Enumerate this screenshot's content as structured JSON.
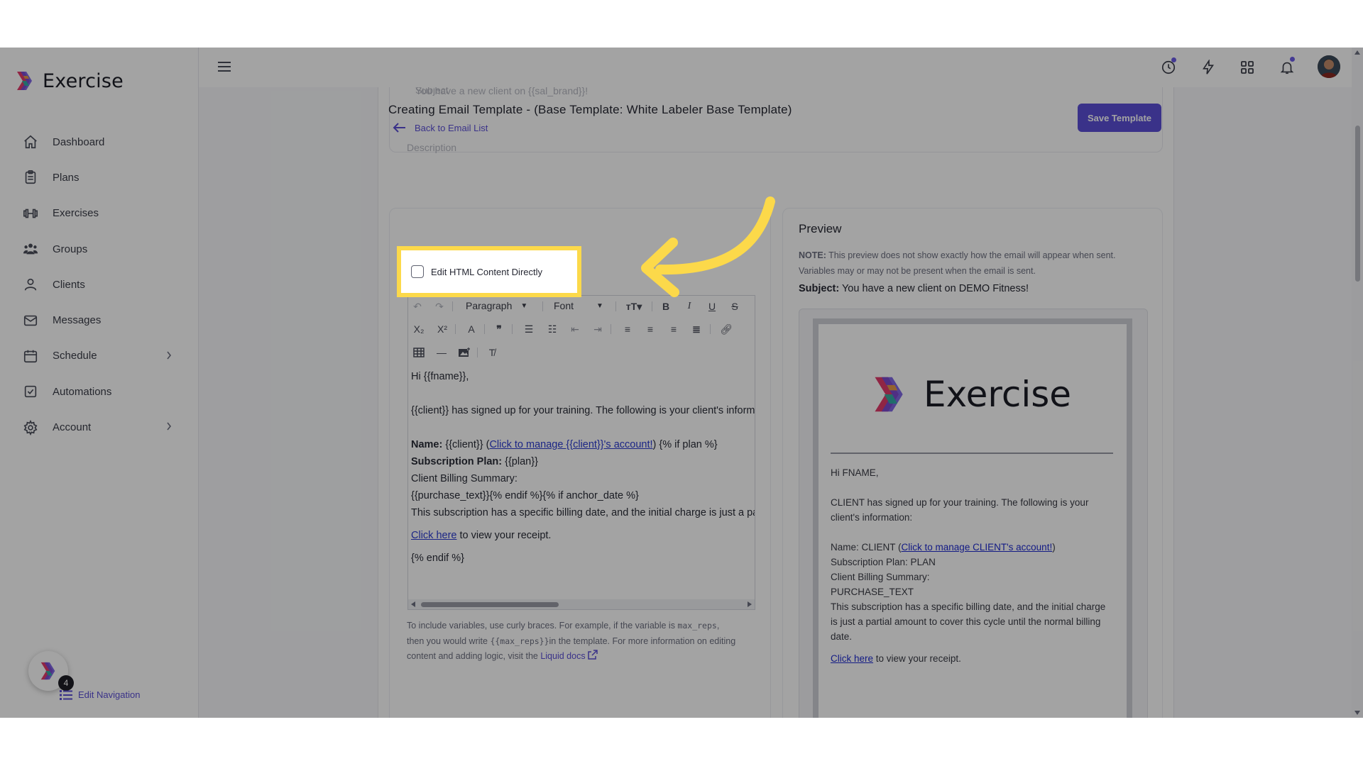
{
  "brand": {
    "name": "Exercise"
  },
  "sidebar": {
    "items": [
      {
        "label": "Dashboard",
        "icon": "home-icon"
      },
      {
        "label": "Plans",
        "icon": "clipboard-icon"
      },
      {
        "label": "Exercises",
        "icon": "dumbbell-icon"
      },
      {
        "label": "Groups",
        "icon": "users-icon"
      },
      {
        "label": "Clients",
        "icon": "user-icon"
      },
      {
        "label": "Messages",
        "icon": "mail-icon"
      },
      {
        "label": "Schedule",
        "icon": "calendar-icon",
        "has_submenu": true
      },
      {
        "label": "Automations",
        "icon": "checkbox-icon"
      },
      {
        "label": "Account",
        "icon": "gear-icon",
        "has_submenu": true
      }
    ],
    "help_badge_count": "4",
    "edit_navigation_label": "Edit Navigation"
  },
  "topbar": {
    "icons": [
      "history-icon",
      "lightning-icon",
      "apps-grid-icon",
      "bell-icon",
      "user-avatar"
    ]
  },
  "page": {
    "ghost_texts": [
      "Subject",
      "You have a new client on {{sal_brand}}!",
      "Description"
    ],
    "title": "Creating Email Template - (Base Template: White Labeler Base Template)",
    "back_label": "Back to Email List",
    "save_label": "Save Template"
  },
  "editor": {
    "html_toggle_label": "Edit HTML Content Directly",
    "html_toggle_checked": false,
    "paragraph_select": "Paragraph",
    "font_select": "Font",
    "content": {
      "greeting": "Hi {{fname}},",
      "intro": "{{client}} has signed up for your training. The following is your client's information:",
      "name_label": "Name:",
      "name_value": "{{client}} (",
      "name_link": "Click to manage {{client}}'s account!",
      "name_tail": ") {% if plan %}",
      "plan_label": "Subscription Plan:",
      "plan_value": "{{plan}}",
      "billing": "Client Billing Summary:",
      "purchase": "{{purchase_text}}{% endif %}{% if anchor_date %}",
      "anchor": "This subscription has a specific billing date, and the initial charge is just a partial amount to cover this cycle until the normal billing date.",
      "receipt_link": "Click here",
      "receipt_tail": " to view your receipt.",
      "endif": "{% endif %}"
    },
    "help_prefix": "To include variables, use curly braces. For example, if the variable is ",
    "help_var": "max_reps",
    "help_mid1": ",",
    "help_mid2": "then you would write ",
    "help_var2": "{{max_reps}}",
    "help_mid3": "in the template. For more information on editing content and adding logic, visit the ",
    "help_link": "Liquid docs"
  },
  "preview": {
    "title": "Preview",
    "note_label": "NOTE:",
    "note_text": " This preview does not show exactly how the email will appear when sent. Variables may or may not be present when the email is sent.",
    "subject_label": "Subject:",
    "subject_value": " You have a new client on DEMO Fitness!",
    "email": {
      "logo_text": "Exercise",
      "greeting": "Hi FNAME,",
      "intro": "CLIENT has signed up for your training. The following is your client's information:",
      "name_prefix": "Name: CLIENT (",
      "name_link": "Click to manage CLIENT's account!",
      "name_suffix": ")",
      "plan": "Subscription Plan: PLAN",
      "billing": "Client Billing Summary:",
      "purchase": "PURCHASE_TEXT",
      "anchor": "This subscription has a specific billing date, and the initial charge is just a partial amount to cover this cycle until the normal billing date.",
      "receipt_link": "Click here",
      "receipt_tail": " to view your receipt."
    }
  },
  "colors": {
    "accent": "#5b4fd6",
    "highlight": "#fcd94a",
    "link": "#2b3bd0"
  }
}
